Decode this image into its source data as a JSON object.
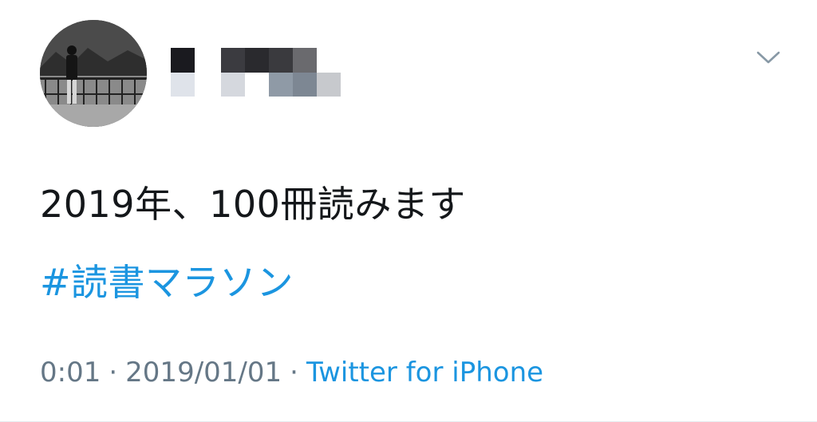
{
  "tweet": {
    "text": "2019年、100冊読みます",
    "hashtag": "#読書マラソン",
    "time": "0:01",
    "separator": "·",
    "date": "2019/01/01",
    "source": "Twitter for iPhone"
  },
  "icons": {
    "more": "chevron-down-icon"
  },
  "colors": {
    "text": "#14171a",
    "link": "#1b95e0",
    "meta": "#657786"
  }
}
